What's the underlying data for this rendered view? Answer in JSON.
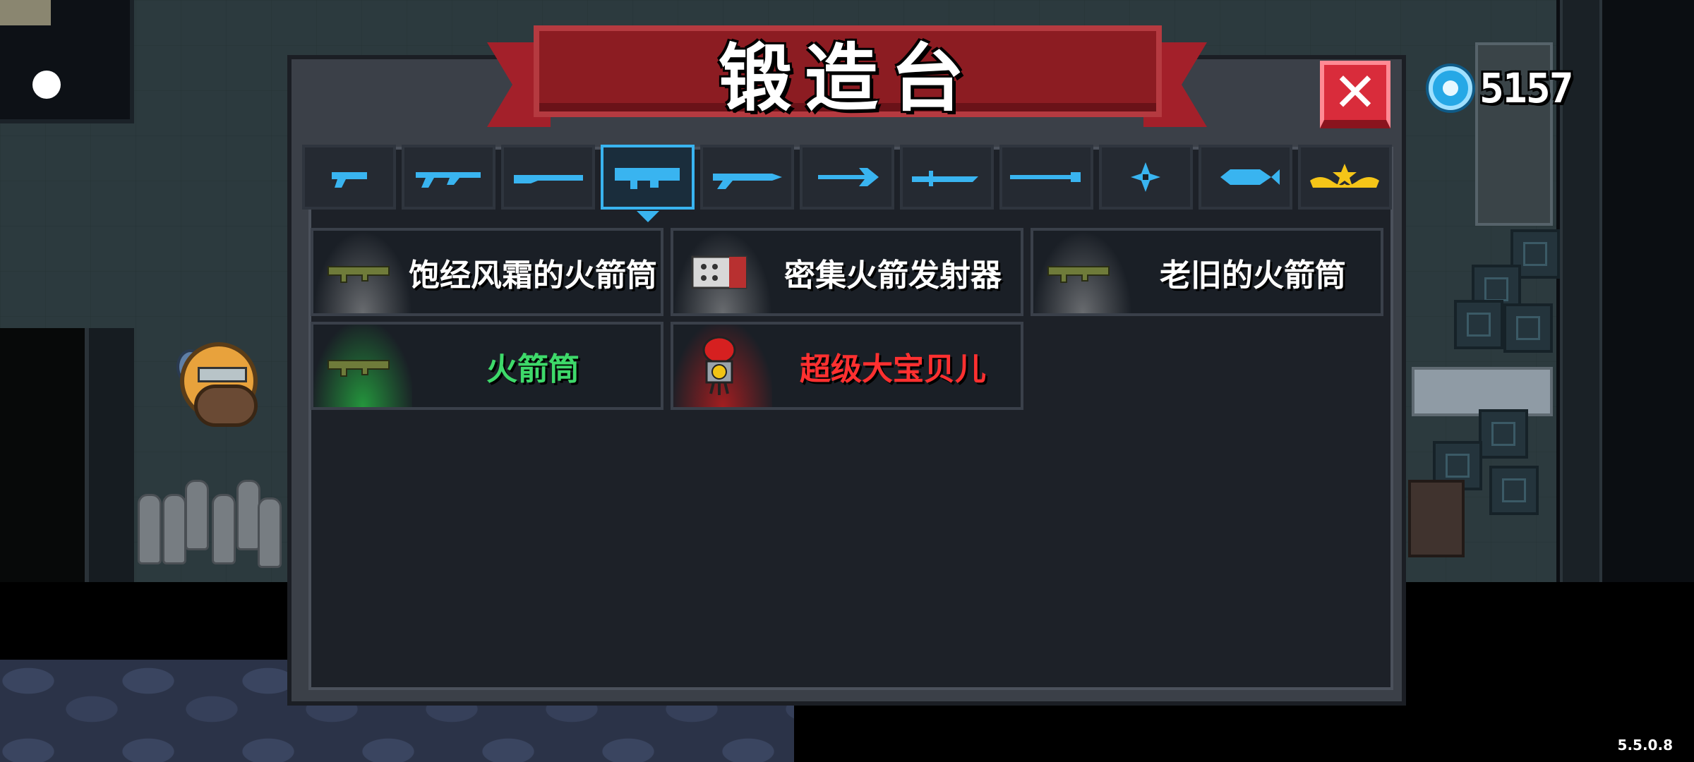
{
  "title": "锻造台",
  "close_label": "✕",
  "currency": {
    "icon": "blue-gem-icon",
    "amount": "5157"
  },
  "version": "5.5.0.8",
  "tabs": [
    {
      "icon": "pistol-icon",
      "active": false
    },
    {
      "icon": "rifle-icon",
      "active": false
    },
    {
      "icon": "shotgun-icon",
      "active": false
    },
    {
      "icon": "launcher-icon",
      "active": true
    },
    {
      "icon": "laser-gun-icon",
      "active": false
    },
    {
      "icon": "bow-icon",
      "active": false
    },
    {
      "icon": "sword-icon",
      "active": false
    },
    {
      "icon": "staff-icon",
      "active": false
    },
    {
      "icon": "shuriken-icon",
      "active": false
    },
    {
      "icon": "fish-icon",
      "active": false
    },
    {
      "icon": "special-crown-icon",
      "active": false
    }
  ],
  "weapons": [
    {
      "name": "饱经风霜的火箭筒",
      "rarity": "white",
      "icon": "rocket-launcher-icon"
    },
    {
      "name": "密集火箭发射器",
      "rarity": "white",
      "icon": "rocket-pod-icon"
    },
    {
      "name": "老旧的火箭筒",
      "rarity": "white",
      "icon": "rocket-launcher-icon"
    },
    {
      "name": "火箭筒",
      "rarity": "green",
      "icon": "rocket-launcher-icon"
    },
    {
      "name": "超级大宝贝儿",
      "rarity": "red",
      "icon": "nuke-bomb-icon"
    }
  ],
  "colors": {
    "tab_icon": "#39b4f0",
    "active_tab": "#39b4f0",
    "banner": "#8c1c22",
    "close": "#d92c3b",
    "green": "#3ed96a",
    "red": "#ff3030"
  }
}
